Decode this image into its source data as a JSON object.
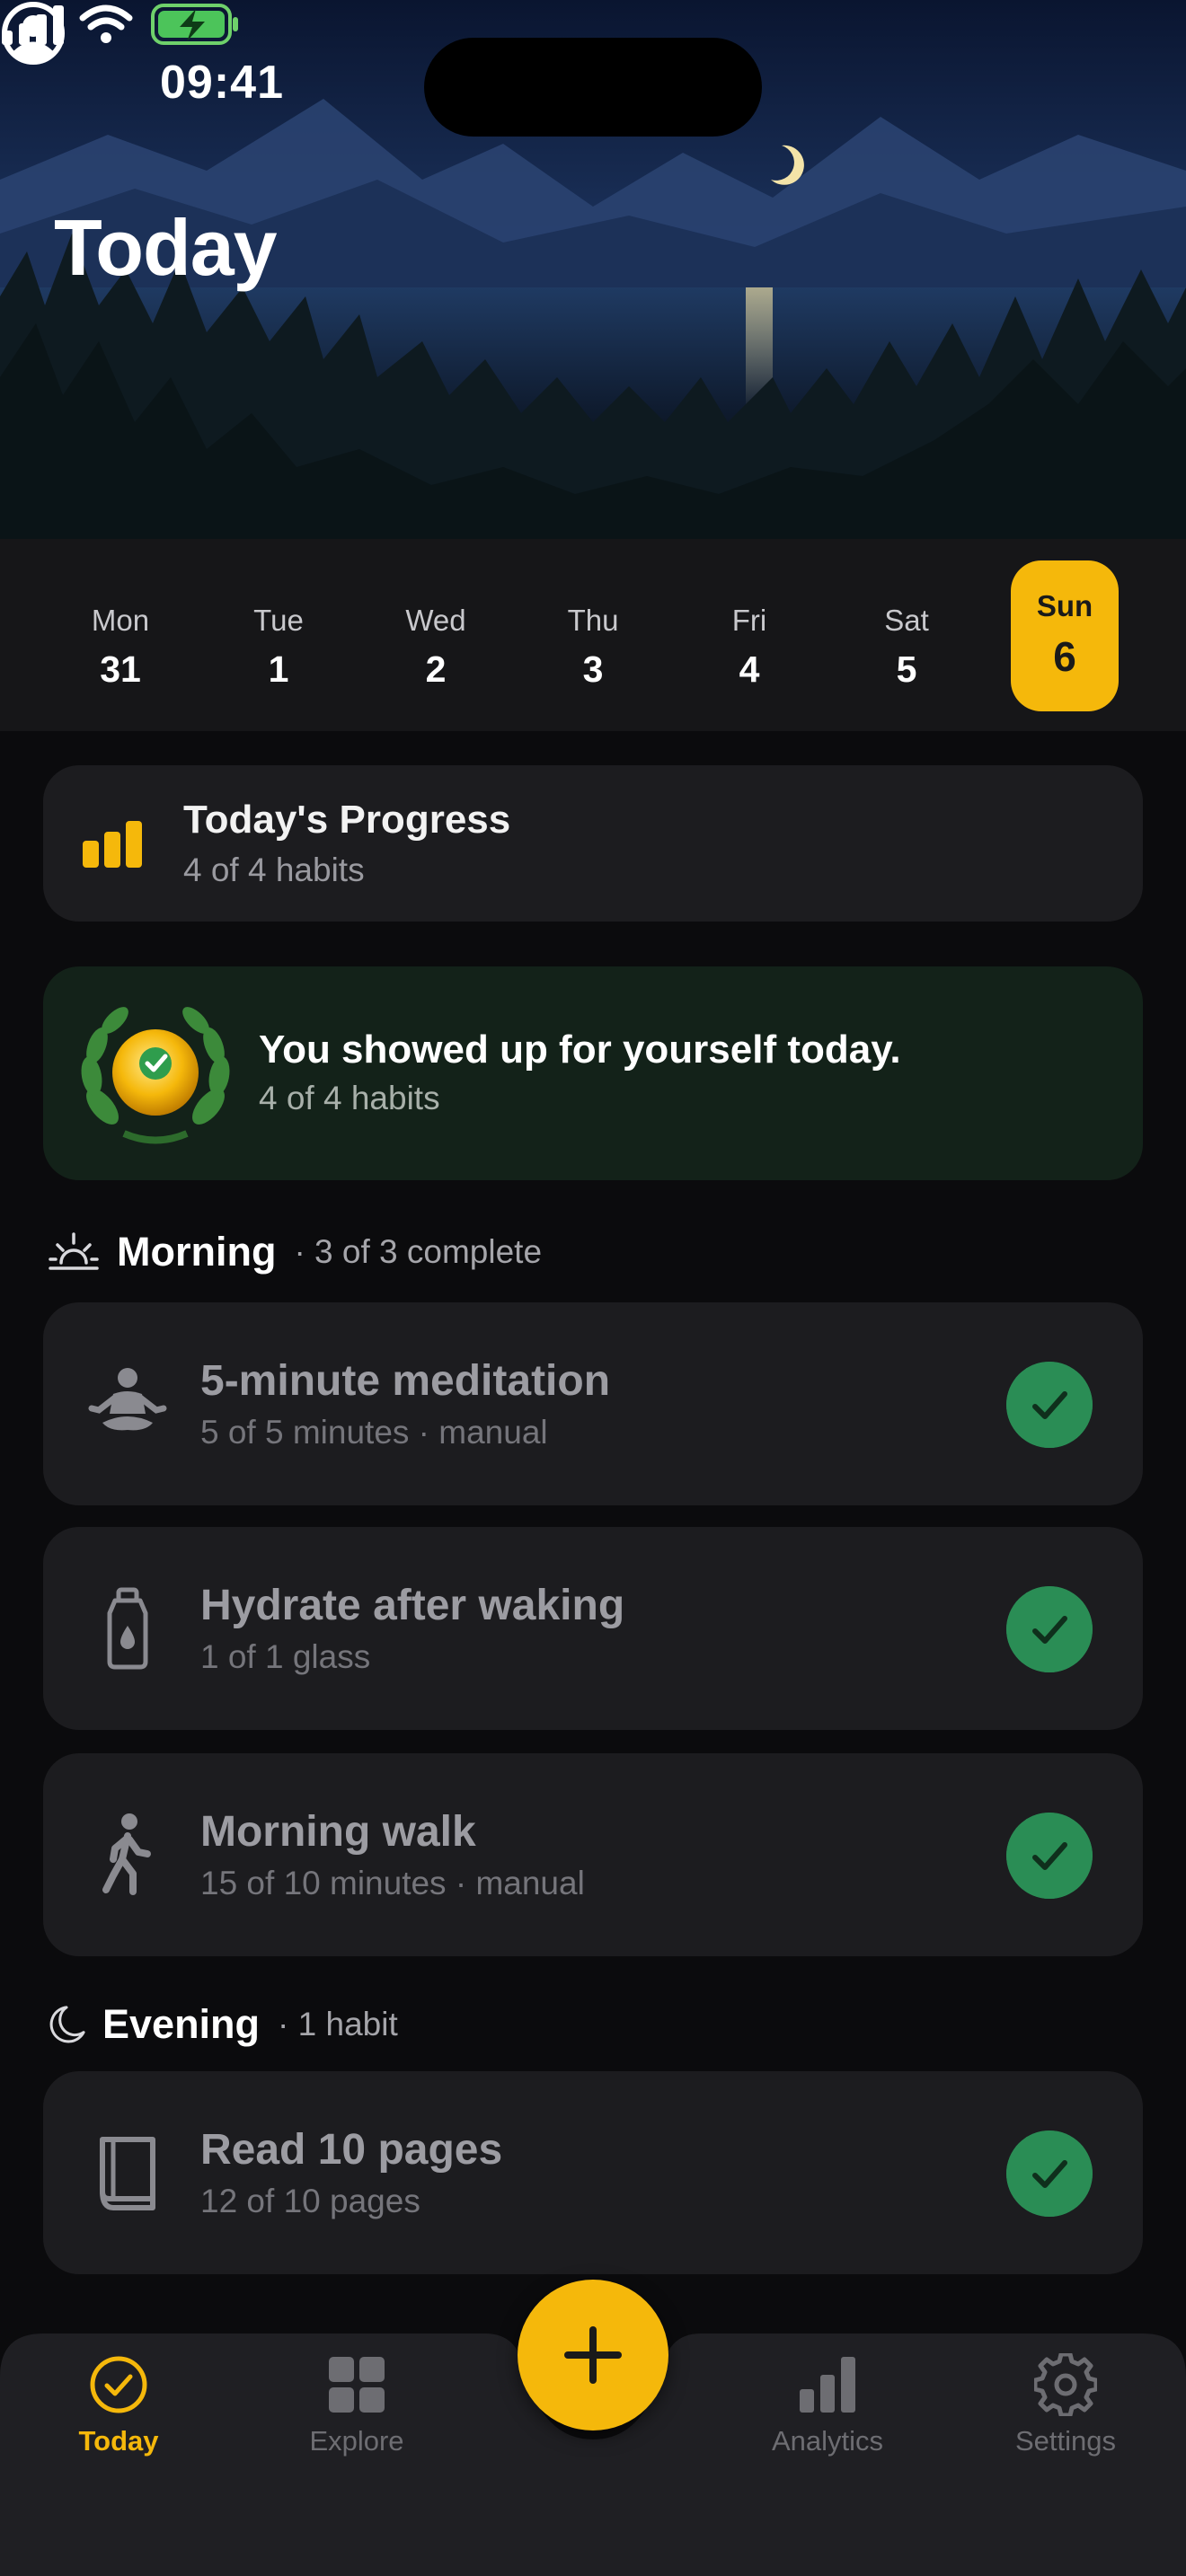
{
  "status_bar": {
    "time": "09:41"
  },
  "header": {
    "title": "Today"
  },
  "week": [
    {
      "day": "Mon",
      "date": "31",
      "active": false
    },
    {
      "day": "Tue",
      "date": "1",
      "active": false
    },
    {
      "day": "Wed",
      "date": "2",
      "active": false
    },
    {
      "day": "Thu",
      "date": "3",
      "active": false
    },
    {
      "day": "Fri",
      "date": "4",
      "active": false
    },
    {
      "day": "Sat",
      "date": "5",
      "active": false
    },
    {
      "day": "Sun",
      "date": "6",
      "active": true
    }
  ],
  "progress": {
    "title": "Today's Progress",
    "subtitle": "4 of 4 habits"
  },
  "celebration": {
    "title": "You showed up for yourself today.",
    "subtitle": "4 of 4 habits"
  },
  "sections": {
    "morning": {
      "title": "Morning",
      "meta": "· 3 of 3 complete",
      "habits": [
        {
          "name": "5-minute meditation",
          "detail": "5 of 5 minutes · manual",
          "icon": "meditation-icon",
          "done": true
        },
        {
          "name": "Hydrate after waking",
          "detail": "1 of 1 glass",
          "icon": "water-bottle-icon",
          "done": true
        },
        {
          "name": "Morning walk",
          "detail": "15 of 10 minutes · manual",
          "icon": "walking-icon",
          "done": true
        }
      ]
    },
    "evening": {
      "title": "Evening",
      "meta": "· 1 habit",
      "habits": [
        {
          "name": "Read 10 pages",
          "detail": "12 of 10 pages",
          "icon": "book-icon",
          "done": true
        }
      ]
    }
  },
  "tabbar": {
    "today": "Today",
    "explore": "Explore",
    "analytics": "Analytics",
    "settings": "Settings"
  },
  "colors": {
    "accent": "#f5b80b",
    "success": "#2a8d55",
    "card": "#1c1c1f",
    "background": "#0b0b0d"
  }
}
